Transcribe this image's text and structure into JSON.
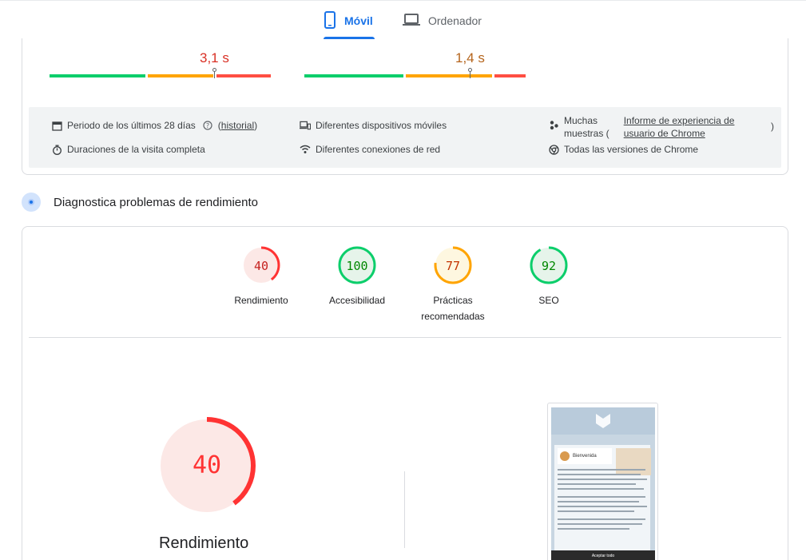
{
  "tabs": {
    "mobile": {
      "label": "Móvil",
      "icon": "smartphone-icon"
    },
    "desktop": {
      "label": "Ordenador",
      "icon": "laptop-icon"
    }
  },
  "metrics": [
    {
      "value": "3,1 s",
      "color": "#d93025"
    },
    {
      "value": "1,4 s",
      "color": "#b5651d"
    }
  ],
  "info": {
    "period_label": "Periodo de los últimos 28 días",
    "history_open": "(",
    "history_link": "historial",
    "history_close": ")",
    "devices": "Diferentes dispositivos móviles",
    "samples_prefix": "Muchas",
    "samples_line2": "muestras (",
    "samples_link_line1": "Informe de experiencia de",
    "samples_link_line2": "usuario de Chrome",
    "samples_close": ")",
    "duration": "Duraciones de la visita completa",
    "connections": "Diferentes conexiones de red",
    "versions": "Todas las versiones de Chrome"
  },
  "diagnose": {
    "title": "Diagnostica problemas de rendimiento"
  },
  "scores": [
    {
      "label": "Rendimiento",
      "score": "40",
      "value": 40,
      "color": "#ff3333",
      "fill": "#fce8e6",
      "text": "#c5221f"
    },
    {
      "label": "Accesibilidad",
      "score": "100",
      "value": 100,
      "color": "#0cce6b",
      "fill": "#e6f4ea",
      "text": "#008800"
    },
    {
      "label_line1": "Prácticas",
      "label_line2": "recomendadas",
      "score": "77",
      "value": 77,
      "color": "#ffa400",
      "fill": "#fef7e0",
      "text": "#c33300"
    },
    {
      "label": "SEO",
      "score": "92",
      "value": 92,
      "color": "#0cce6b",
      "fill": "#e6f4ea",
      "text": "#008800"
    }
  ],
  "main_score": {
    "score": "40",
    "value": 40,
    "label": "Rendimiento",
    "color": "#ff3333",
    "fill": "#fce8e6"
  },
  "phone": {
    "welcome": "Bienvenida",
    "bottom": "Aceptar todo"
  }
}
